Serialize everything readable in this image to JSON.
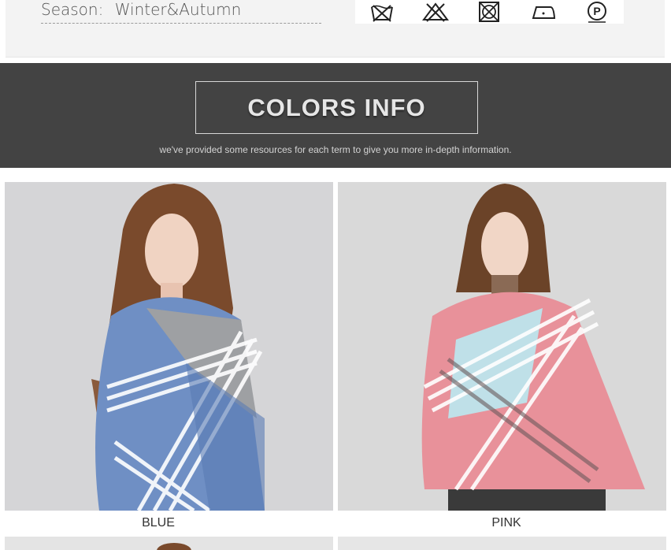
{
  "spec": {
    "season_label": "Season:",
    "season_value": "Winter&Autumn"
  },
  "care_icons": [
    "no-wash-icon",
    "no-bleach-icon",
    "no-tumble-dry-icon",
    "iron-low-icon",
    "dry-clean-p-icon"
  ],
  "banner": {
    "title": "COLORS INFO",
    "subtitle": "we've provided some resources for each term to give you more in-depth information."
  },
  "colors": [
    {
      "name": "BLUE",
      "accent": "#6f8fc4"
    },
    {
      "name": "PINK",
      "accent": "#e8919a"
    }
  ]
}
